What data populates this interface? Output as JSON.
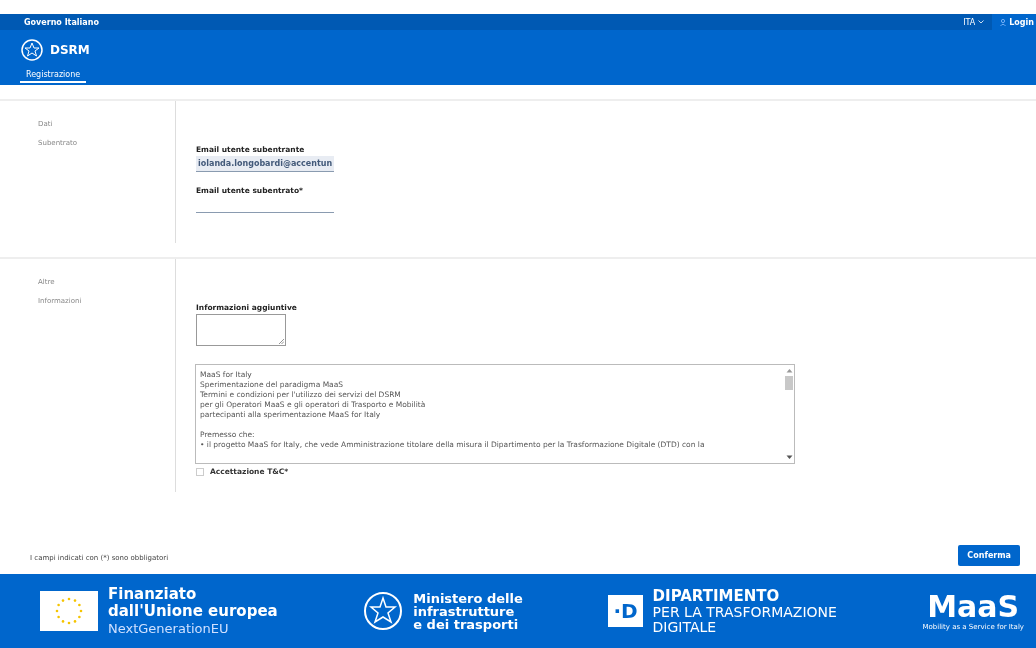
{
  "top_bar": {
    "brand": "Governo Italiano",
    "language": "ITA",
    "login": "Login"
  },
  "header": {
    "title": "DSRM",
    "tabs": [
      {
        "label": "Registrazione",
        "selected": true
      }
    ]
  },
  "sections": [
    {
      "title": "Dati\nSubentrato",
      "fields": [
        {
          "kind": "input",
          "label": "Email utente subentrante",
          "value": "iolanda.longobardi@accentun",
          "disabled": true
        },
        {
          "kind": "input",
          "label": "Email utente subentrato*",
          "disabled": false
        }
      ]
    },
    {
      "title": "Altre\nInformazioni",
      "fields": [
        {
          "kind": "textarea",
          "label": "Informazioni aggiuntive"
        },
        {
          "kind": "terms",
          "paragraphs": [
            [
              "MaaS for Italy",
              "Sperimentazione del paradigma MaaS",
              "Termini e condizioni per l'utilizzo dei servizi del DSRM",
              "per gli Operatori MaaS e gli operatori di Trasporto e Mobilità",
              "partecipanti alla sperimentazione MaaS for Italy"
            ],
            [
              "Premesso che:",
              "• il progetto MaaS for Italy, che vede Amministrazione titolare della misura il Dipartimento per la Trasformazione Digitale (DTD) con la"
            ]
          ]
        },
        {
          "kind": "checkbox",
          "label": "Accettazione T&C*",
          "checked": false
        }
      ]
    }
  ],
  "required_note": "I campi indicati con (*) sono obbligatori",
  "confirm_button": "Conferma",
  "footer": [
    {
      "kind": "eu",
      "lines": [
        "Finanziato",
        "dall'Unione europea",
        "NextGenerationEU"
      ]
    },
    {
      "kind": "ministry",
      "lines": [
        "Ministero delle",
        "infrastrutture",
        "e dei trasporti"
      ]
    },
    {
      "kind": "dtd",
      "mark": "·D",
      "lines": [
        "DIPARTIMENTO",
        "PER LA TRASFORMAZIONE",
        "DIGITALE"
      ]
    },
    {
      "kind": "maas",
      "mark": "MaaS",
      "lines": [
        "Mobility as a Service for Italy"
      ]
    }
  ]
}
